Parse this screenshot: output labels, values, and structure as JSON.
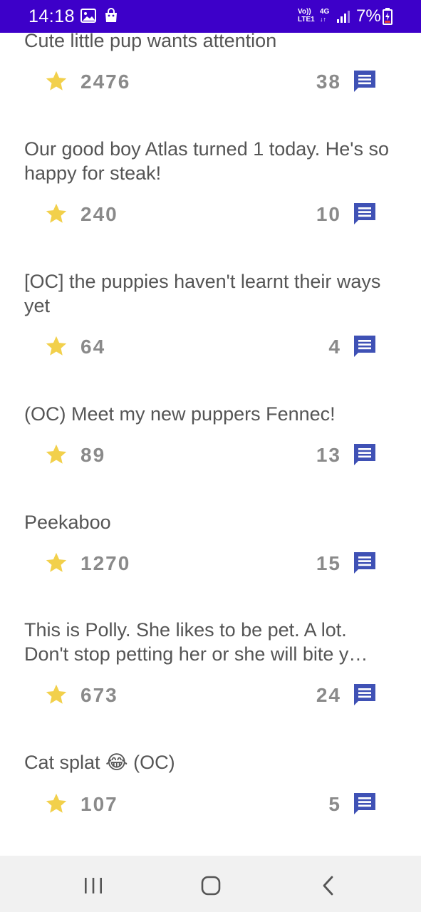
{
  "status_bar": {
    "time": "14:18",
    "network_label_top": "Vo))",
    "network_label_bottom": "LTE1",
    "network_type": "4G",
    "battery": "7%",
    "icons": [
      "gallery-icon",
      "shopping-bag-icon",
      "signal-icon",
      "battery-charging-icon"
    ]
  },
  "posts": [
    {
      "title": "Cute little pup wants attention",
      "score": "2476",
      "comments": "38"
    },
    {
      "title": "Our good boy Atlas turned 1 today. He's so happy for steak!",
      "score": "240",
      "comments": "10"
    },
    {
      "title": "[OC] the puppies haven't learnt their ways yet",
      "score": "64",
      "comments": "4"
    },
    {
      "title": "(OC) Meet my new puppers Fennec!",
      "score": "89",
      "comments": "13"
    },
    {
      "title": "Peekaboo",
      "score": "1270",
      "comments": "15"
    },
    {
      "title": "This is Polly. She likes to be pet. A lot. Don't stop petting her or she will bite y…",
      "score": "673",
      "comments": "24"
    },
    {
      "title": "Cat splat 😂 (OC)",
      "score": "107",
      "comments": "5"
    }
  ],
  "colors": {
    "status_bar": "#3d00c9",
    "star": "#f2d04b",
    "comment_icon": "#3f51b5",
    "text": "#555555",
    "count_text": "#8a8a8a",
    "nav_bar": "#f1f1f1"
  },
  "nav_bar": {
    "buttons": [
      "recent-apps-icon",
      "home-icon",
      "back-icon"
    ]
  }
}
